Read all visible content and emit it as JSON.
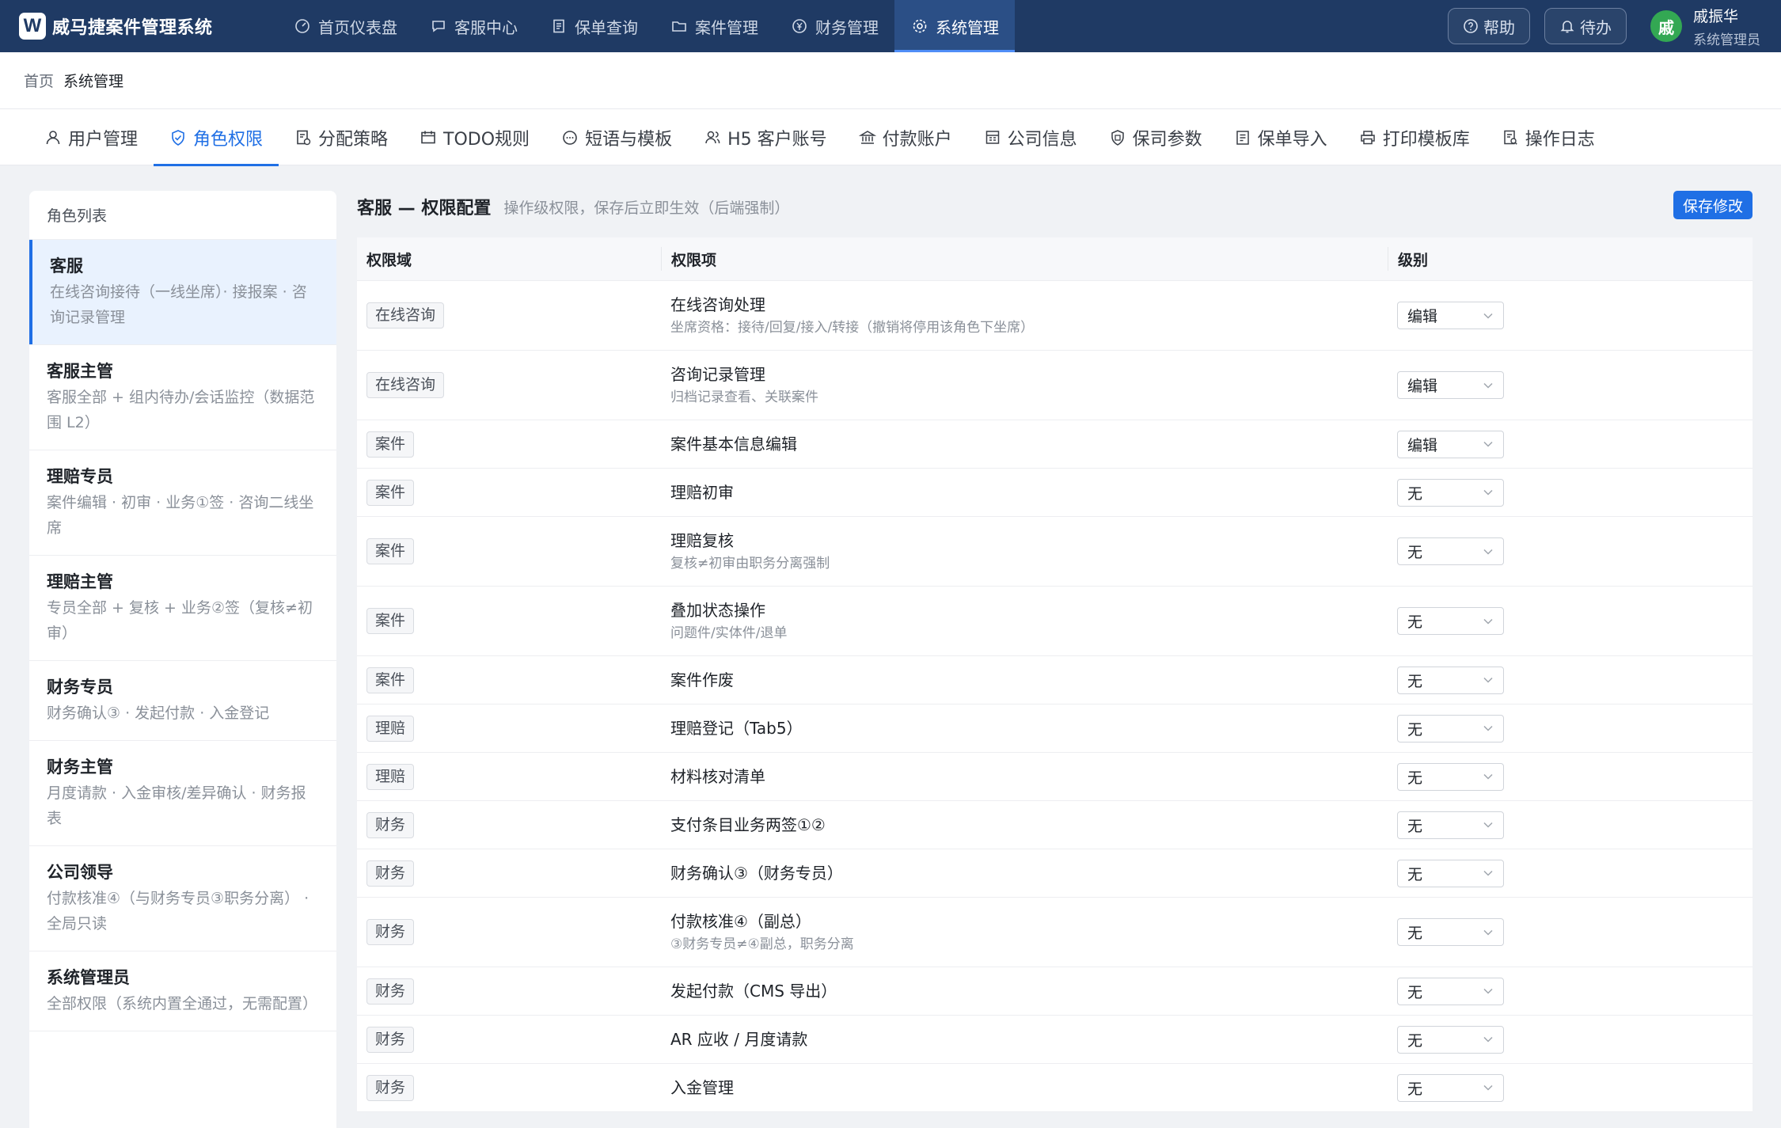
{
  "app": {
    "logo_letter": "W",
    "title": "威马捷案件管理系统"
  },
  "nav": [
    {
      "label": "首页仪表盘",
      "icon": "dashboard-icon"
    },
    {
      "label": "客服中心",
      "icon": "chat-icon"
    },
    {
      "label": "保单查询",
      "icon": "document-icon"
    },
    {
      "label": "案件管理",
      "icon": "folder-icon"
    },
    {
      "label": "财务管理",
      "icon": "yen-icon"
    },
    {
      "label": "系统管理",
      "icon": "gear-icon",
      "active": true
    }
  ],
  "topright": {
    "help": "帮助",
    "todo": "待办",
    "avatar": "戚",
    "user_name": "戚振华",
    "user_role": "系统管理员"
  },
  "breadcrumb": {
    "home": "首页",
    "current": "系统管理"
  },
  "subtabs": [
    {
      "label": "用户管理",
      "icon": "user-icon"
    },
    {
      "label": "角色权限",
      "icon": "shield-check-icon",
      "active": true
    },
    {
      "label": "分配策略",
      "icon": "assign-icon"
    },
    {
      "label": "TODO规则",
      "icon": "calendar-icon"
    },
    {
      "label": "短语与模板",
      "icon": "message-icon"
    },
    {
      "label": "H5 客户账号",
      "icon": "users-icon"
    },
    {
      "label": "付款账户",
      "icon": "bank-icon"
    },
    {
      "label": "公司信息",
      "icon": "building-icon"
    },
    {
      "label": "保司参数",
      "icon": "badge-icon"
    },
    {
      "label": "保单导入",
      "icon": "import-icon"
    },
    {
      "label": "打印模板库",
      "icon": "printer-icon"
    },
    {
      "label": "操作日志",
      "icon": "log-icon"
    }
  ],
  "roles": {
    "header": "角色列表",
    "items": [
      {
        "name": "客服",
        "desc": "在线咨询接待（一线坐席）· 接报案 · 咨询记录管理",
        "active": true
      },
      {
        "name": "客服主管",
        "desc": "客服全部 + 组内待办/会话监控（数据范围 L2）"
      },
      {
        "name": "理赔专员",
        "desc": "案件编辑 · 初审 · 业务①签 · 咨询二线坐席"
      },
      {
        "name": "理赔主管",
        "desc": "专员全部 + 复核 + 业务②签（复核≠初审）"
      },
      {
        "name": "财务专员",
        "desc": "财务确认③ · 发起付款 · 入金登记"
      },
      {
        "name": "财务主管",
        "desc": "月度请款 · 入金审核/差异确认 · 财务报表"
      },
      {
        "name": "公司领导",
        "desc": "付款核准④（与财务专员③职务分离） · 全局只读"
      },
      {
        "name": "系统管理员",
        "desc": "全部权限（系统内置全通过，无需配置）"
      }
    ]
  },
  "main": {
    "title": "客服 — 权限配置",
    "subtitle": "操作级权限，保存后立即生效（后端强制）",
    "save_label": "保存修改",
    "columns": {
      "domain": "权限域",
      "item": "权限项",
      "level": "级别"
    },
    "rows": [
      {
        "domain": "在线咨询",
        "name": "在线咨询处理",
        "note": "坐席资格：接待/回复/接入/转接（撤销将停用该角色下坐席）",
        "level": "编辑"
      },
      {
        "domain": "在线咨询",
        "name": "咨询记录管理",
        "note": "归档记录查看、关联案件",
        "level": "编辑"
      },
      {
        "domain": "案件",
        "name": "案件基本信息编辑",
        "note": "",
        "level": "编辑"
      },
      {
        "domain": "案件",
        "name": "理赔初审",
        "note": "",
        "level": "无"
      },
      {
        "domain": "案件",
        "name": "理赔复核",
        "note": "复核≠初审由职务分离强制",
        "level": "无"
      },
      {
        "domain": "案件",
        "name": "叠加状态操作",
        "note": "问题件/实体件/退单",
        "level": "无"
      },
      {
        "domain": "案件",
        "name": "案件作废",
        "note": "",
        "level": "无"
      },
      {
        "domain": "理赔",
        "name": "理赔登记（Tab5）",
        "note": "",
        "level": "无"
      },
      {
        "domain": "理赔",
        "name": "材料核对清单",
        "note": "",
        "level": "无"
      },
      {
        "domain": "财务",
        "name": "支付条目业务两签①②",
        "note": "",
        "level": "无"
      },
      {
        "domain": "财务",
        "name": "财务确认③（财务专员）",
        "note": "",
        "level": "无"
      },
      {
        "domain": "财务",
        "name": "付款核准④（副总）",
        "note": "③财务专员≠④副总，职务分离",
        "level": "无"
      },
      {
        "domain": "财务",
        "name": "发起付款（CMS 导出）",
        "note": "",
        "level": "无"
      },
      {
        "domain": "财务",
        "name": "AR 应收 / 月度请款",
        "note": "",
        "level": "无"
      },
      {
        "domain": "财务",
        "name": "入金管理",
        "note": "",
        "level": "无"
      }
    ]
  }
}
